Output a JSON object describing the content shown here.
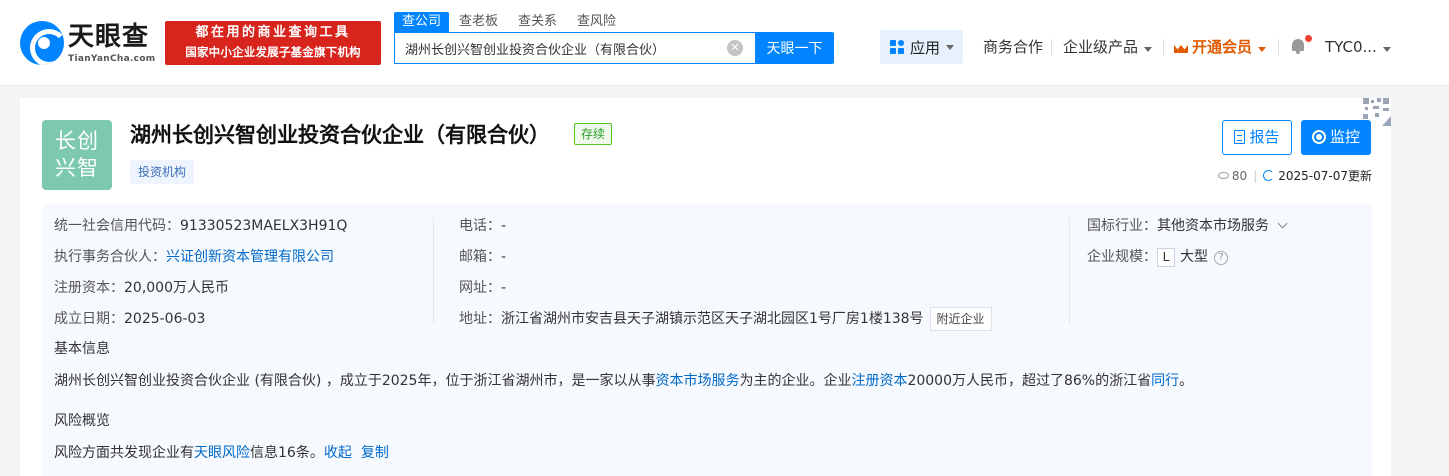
{
  "header": {
    "logo_name": "天眼查",
    "logo_domain": "TianYanCha.com",
    "promo_line1": "都在用的商业查询工具",
    "promo_line2": "国家中小企业发展子基金旗下机构",
    "search_tabs": [
      "查公司",
      "查老板",
      "查关系",
      "查风险"
    ],
    "search_value": "湖州长创兴智创业投资合伙企业（有限合伙）",
    "clear_symbol": "✕",
    "search_button": "天眼一下",
    "nav": {
      "app": "应用",
      "business": "商务合作",
      "enterprise": "企业级产品",
      "vip": "开通会员",
      "user": "TYC0..."
    }
  },
  "company": {
    "avatar_line1": "长创",
    "avatar_line2": "兴智",
    "name": "湖州长创兴智创业投资合伙企业（有限合伙）",
    "status": "存续",
    "tag": "投资机构",
    "report_button": "报告",
    "monitor_button": "监控",
    "views": "80",
    "updated": "2025-07-07更新"
  },
  "info": {
    "credit_code_label": "统一社会信用代码：",
    "credit_code": "91330523MAELX3H91Q",
    "partner_label": "执行事务合伙人：",
    "partner": "兴证创新资本管理有限公司",
    "capital_label": "注册资本：",
    "capital": "20,000万人民币",
    "founded_label": "成立日期：",
    "founded": "2025-06-03",
    "phone_label": "电话：",
    "phone": "-",
    "email_label": "邮箱：",
    "email": "-",
    "website_label": "网址：",
    "website": "-",
    "address_label": "地址：",
    "address": "浙江省湖州市安吉县天子湖镇示范区天子湖北园区1号厂房1楼138号",
    "nearby_button": "附近企业",
    "industry_label": "国标行业：",
    "industry": "其他资本市场服务",
    "scale_label": "企业规模：",
    "scale_badge": "L",
    "scale": "大型",
    "help_symbol": "?"
  },
  "basic": {
    "title": "基本信息",
    "p1": "湖州长创兴智创业投资合伙企业 (有限合伙) ，成立于2025年，位于浙江省湖州市，是一家以从事",
    "link1": "资本市场服务",
    "p2": "为主的企业。企业",
    "link2": "注册资本",
    "p3": "20000万人民币，超过了86%的浙江省",
    "link3": "同行",
    "p4": "。"
  },
  "risk": {
    "title": "风险概览",
    "p1": "风险方面共发现企业有",
    "link1": "天眼风险",
    "p2": "信息16条。",
    "collapse": "收起",
    "copy": "复制"
  }
}
